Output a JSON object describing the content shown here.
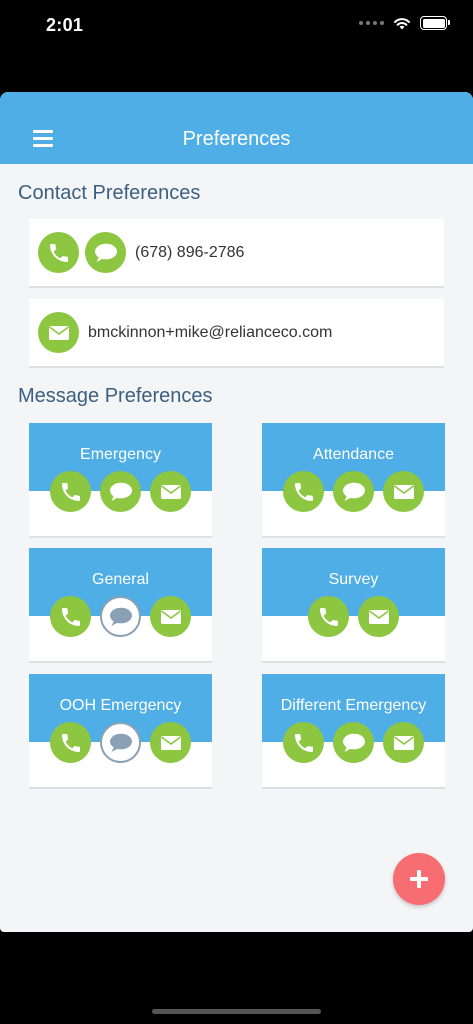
{
  "status_bar": {
    "time": "2:01"
  },
  "header": {
    "title": "Preferences"
  },
  "contact": {
    "title": "Contact Preferences",
    "phone": "(678) 896-2786",
    "email": "bmckinnon+mike@relianceco.com"
  },
  "messages": {
    "title": "Message Preferences",
    "cards": [
      {
        "label": "Emergency",
        "channels": [
          {
            "icon": "phone-icon",
            "on": true
          },
          {
            "icon": "chat-icon",
            "on": true
          },
          {
            "icon": "mail-icon",
            "on": true
          }
        ]
      },
      {
        "label": "Attendance",
        "channels": [
          {
            "icon": "phone-icon",
            "on": true
          },
          {
            "icon": "chat-icon",
            "on": true
          },
          {
            "icon": "mail-icon",
            "on": true
          }
        ]
      },
      {
        "label": "General",
        "channels": [
          {
            "icon": "phone-icon",
            "on": true
          },
          {
            "icon": "chat-icon",
            "on": false
          },
          {
            "icon": "mail-icon",
            "on": true
          }
        ]
      },
      {
        "label": "Survey",
        "channels": [
          {
            "icon": "phone-icon",
            "on": true
          },
          {
            "icon": "mail-icon",
            "on": true
          }
        ]
      },
      {
        "label": "OOH Emergency",
        "channels": [
          {
            "icon": "phone-icon",
            "on": true
          },
          {
            "icon": "chat-icon",
            "on": false
          },
          {
            "icon": "mail-icon",
            "on": true
          }
        ]
      },
      {
        "label": "Different Emergency",
        "channels": [
          {
            "icon": "phone-icon",
            "on": true
          },
          {
            "icon": "chat-icon",
            "on": true
          },
          {
            "icon": "mail-icon",
            "on": true
          }
        ]
      }
    ]
  },
  "colors": {
    "accent": "#4eaee5",
    "enabled": "#8dc640",
    "disabled": "#8aa0b4",
    "fab": "#f76d72",
    "heading": "#3d5f7f"
  }
}
